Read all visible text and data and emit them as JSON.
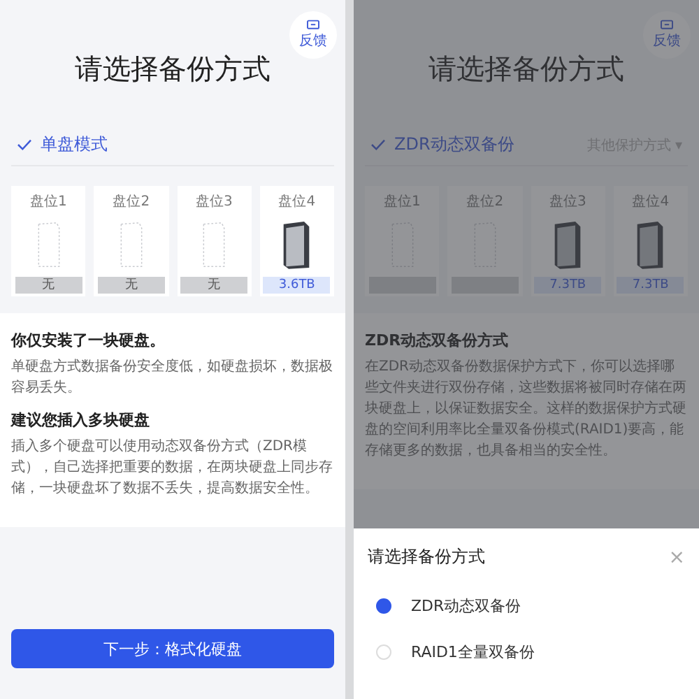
{
  "screens": [
    {
      "dimmed": false,
      "feedback": "反馈",
      "title": "请选择备份方式",
      "mode": "单盘模式",
      "slots": [
        {
          "label": "盘位1",
          "installed": false,
          "capacity": "无"
        },
        {
          "label": "盘位2",
          "installed": false,
          "capacity": "无"
        },
        {
          "label": "盘位3",
          "installed": false,
          "capacity": "无"
        },
        {
          "label": "盘位4",
          "installed": true,
          "capacity": "3.6TB"
        }
      ],
      "sections": [
        {
          "heading": "你仅安装了一块硬盘。",
          "body": "单硬盘方式数据备份安全度低，如硬盘损坏，数据极容易丢失。"
        },
        {
          "heading": "建议您插入多块硬盘",
          "body": "插入多个硬盘可以使用动态双备份方式（ZDR模式），自己选择把重要的数据，在两块硬盘上同步存储，一块硬盘坏了数据不丢失，提高数据安全性。"
        }
      ],
      "button": "下一步：格式化硬盘"
    },
    {
      "dimmed": true,
      "feedback": "反馈",
      "title": "请选择备份方式",
      "mode": "ZDR动态双备份",
      "other": "其他保护方式 ▾",
      "slots": [
        {
          "label": "盘位1",
          "installed": false
        },
        {
          "label": "盘位2",
          "installed": false
        },
        {
          "label": "盘位3",
          "installed": true,
          "capacity": "7.3TB"
        },
        {
          "label": "盘位4",
          "installed": true,
          "capacity": "7.3TB"
        }
      ],
      "sections": [
        {
          "heading": "ZDR动态双备份方式",
          "body": "在ZDR动态双备份数据保护方式下，你可以选择哪些文件夹进行双份存储，这些数据将被同时存储在两块硬盘上，以保证数据安全。这样的数据保护方式硬盘的空间利用率比全量双备份模式(RAID1)要高，能存储更多的数据，也具备相当的安全性。"
        }
      ],
      "sheet": {
        "title": "请选择备份方式",
        "close": "×",
        "options": [
          {
            "label": "ZDR动态双备份",
            "selected": true
          },
          {
            "label": "RAID1全量双备份",
            "selected": false
          }
        ]
      }
    }
  ]
}
